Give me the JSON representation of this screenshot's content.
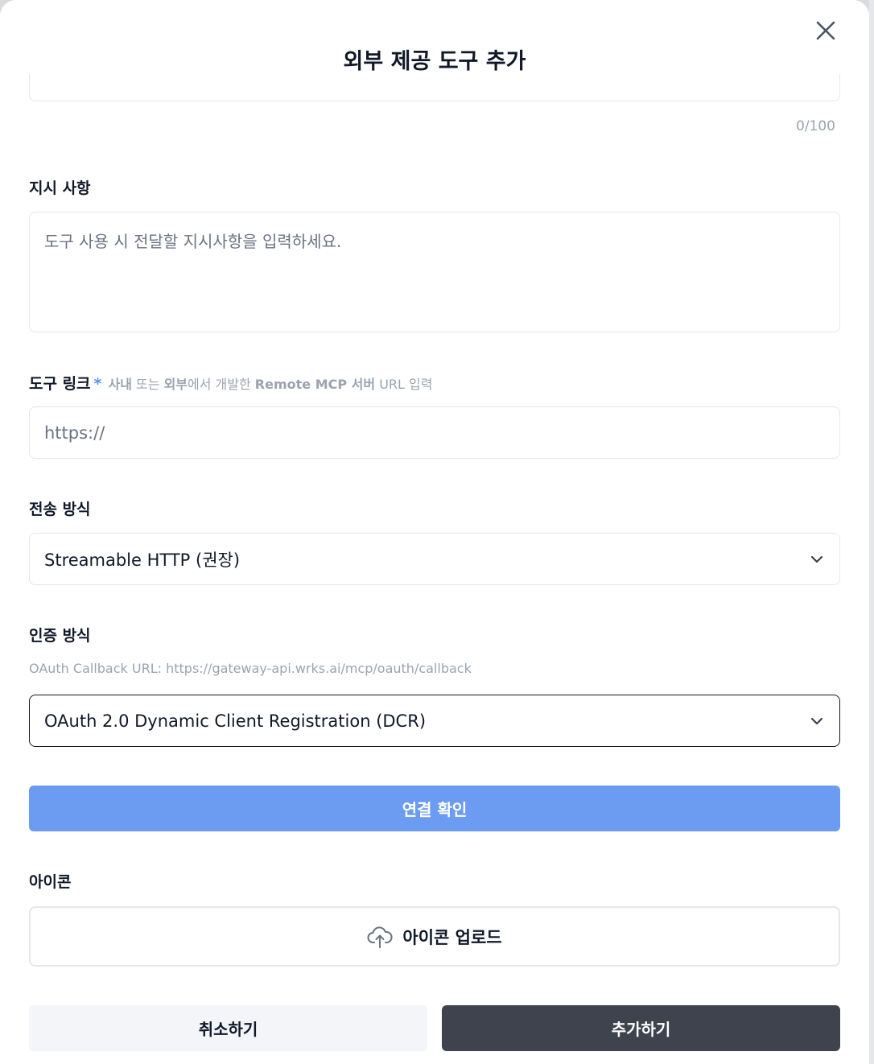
{
  "modal": {
    "title": "외부 제공 도구 추가"
  },
  "description_field": {
    "counter": "0/100"
  },
  "instructions": {
    "label": "지시 사항",
    "placeholder": "도구 사용 시 전달할 지시사항을 입력하세요."
  },
  "tool_link": {
    "label": "도구 링크",
    "required_mark": "*",
    "hint_part1_bold": "사내",
    "hint_part2": " 또는 ",
    "hint_part3_bold": "외부",
    "hint_part4": "에서 개발한 ",
    "hint_part5_bold": "Remote MCP 서버",
    "hint_part6": " URL 입력",
    "placeholder": "https://"
  },
  "transport": {
    "label": "전송 방식",
    "selected": "Streamable HTTP (권장)"
  },
  "auth": {
    "label": "인증 방식",
    "callback_prefix": "OAuth Callback URL: ",
    "callback_url": "https://gateway-api.wrks.ai/mcp/oauth/callback",
    "selected": "OAuth 2.0 Dynamic Client Registration (DCR)"
  },
  "connect_button": "연결 확인",
  "icon_section": {
    "label": "아이콘",
    "upload_label": "아이콘 업로드"
  },
  "footer": {
    "cancel": "취소하기",
    "add": "추가하기"
  },
  "colors": {
    "primary": "#6b9cf2",
    "dark": "#3f434e",
    "muted": "#9ca3af"
  }
}
